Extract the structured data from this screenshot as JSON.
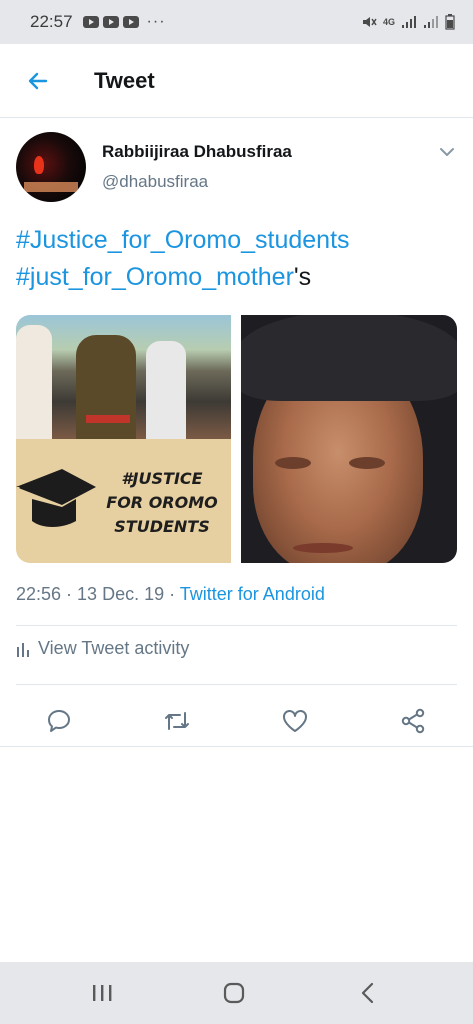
{
  "status_bar": {
    "time": "22:57",
    "dots": "···",
    "network": "4G",
    "icons": [
      "youtube-icon",
      "youtube-icon",
      "youtube-icon",
      "mute-icon",
      "signal-icon",
      "signal-icon",
      "battery-icon"
    ]
  },
  "header": {
    "title": "Tweet",
    "back_icon": "back-arrow-icon"
  },
  "tweet": {
    "author": {
      "display_name": "Rabbiijiraa Dhabusfiraa",
      "handle": "@dhabusfiraa",
      "avatar_caption": "REST IN PEACE"
    },
    "text": {
      "hashtag_1": "#Justice_for_Oromo_students",
      "hashtag_2": "#just_for_Oromo_mother",
      "suffix": "'s"
    },
    "media": {
      "banner_line_1": "#JUSTICE",
      "banner_line_2": "FOR OROMO",
      "banner_line_3": "STUDENTS"
    },
    "meta": {
      "time": "22:56",
      "separator_1": " · ",
      "date": "13 Dec. 19",
      "separator_2": " · ",
      "source": "Twitter for Android"
    },
    "activity_label": "View Tweet activity",
    "actions": [
      "reply-icon",
      "retweet-icon",
      "like-icon",
      "share-icon"
    ]
  },
  "colors": {
    "accent": "#1b95e0",
    "secondary_text": "#657786",
    "divider": "#e1e8ed",
    "system_bar": "#e6e7ea"
  },
  "nav_bar": {
    "buttons": [
      "recent-apps-icon",
      "home-icon",
      "back-icon"
    ]
  }
}
